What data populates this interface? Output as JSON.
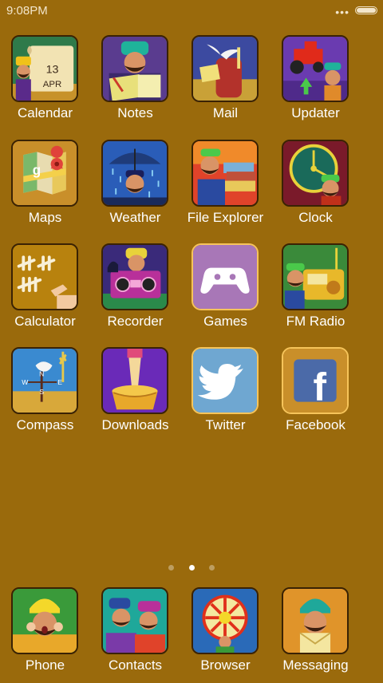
{
  "status": {
    "time": "9:08PM",
    "more_dots": "•••"
  },
  "apps": {
    "calendar": {
      "label": "Calendar",
      "day": "13",
      "month": "APR"
    },
    "notes": {
      "label": "Notes"
    },
    "mail": {
      "label": "Mail"
    },
    "updater": {
      "label": "Updater"
    },
    "maps": {
      "label": "Maps"
    },
    "weather": {
      "label": "Weather"
    },
    "file_explorer": {
      "label": "File Explorer"
    },
    "clock": {
      "label": "Clock"
    },
    "calculator": {
      "label": "Calculator"
    },
    "recorder": {
      "label": "Recorder"
    },
    "games": {
      "label": "Games"
    },
    "fm_radio": {
      "label": "FM Radio"
    },
    "compass": {
      "label": "Compass",
      "dir_n": "N",
      "dir_e": "E",
      "dir_w": "W",
      "dir_s": "S"
    },
    "downloads": {
      "label": "Downloads"
    },
    "twitter": {
      "label": "Twitter"
    },
    "facebook": {
      "label": "Facebook",
      "glyph": "f"
    }
  },
  "dock": {
    "phone": {
      "label": "Phone"
    },
    "contacts": {
      "label": "Contacts"
    },
    "browser": {
      "label": "Browser"
    },
    "messaging": {
      "label": "Messaging"
    }
  },
  "pager": {
    "current_page": 2,
    "total_pages": 3
  },
  "colors": {
    "wallpaper": "#9a6a0c",
    "games_tile": "#a877b7",
    "twitter_tile": "#6fa7d1",
    "facebook_tile": "#c98f2a"
  }
}
